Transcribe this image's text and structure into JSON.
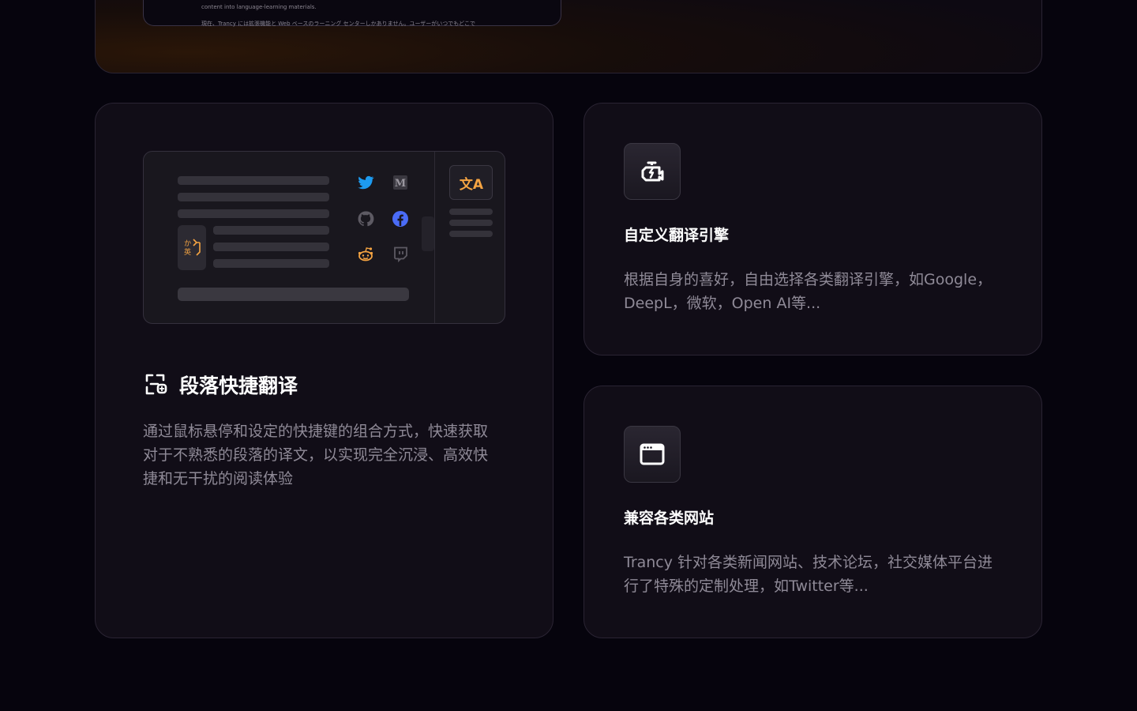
{
  "top_preview": {
    "line1": "content into language-learning materials.",
    "line2": "現在、Trancy には拡張機能と Web ベースのラーニング センターしかありません。ユーザーがいつでもどこで"
  },
  "illustration": {
    "translate_glyph_top": "か",
    "translate_glyph_bottom": "英",
    "side_icon_label": "文A"
  },
  "feature_paragraph": {
    "title": "段落快捷翻译",
    "description": "通过鼠标悬停和设定的快捷键的组合方式，快速获取对于不熟悉的段落的译文，以实现完全沉浸、高效快捷和无干扰的阅读体验"
  },
  "feature_engine": {
    "title": "自定义翻译引擎",
    "description": "根据自身的喜好，自由选择各类翻译引擎，如Google，DeepL，微软，Open AI等..."
  },
  "feature_sites": {
    "title": "兼容各类网站",
    "description": "Trancy 针对各类新闻网站、技术论坛，社交媒体平台进行了特殊的定制处理，如Twitter等..."
  },
  "colors": {
    "accent_orange": "#f5a442",
    "twitter_blue": "#1d9bf0",
    "facebook_blue": "#4a6cf7"
  }
}
